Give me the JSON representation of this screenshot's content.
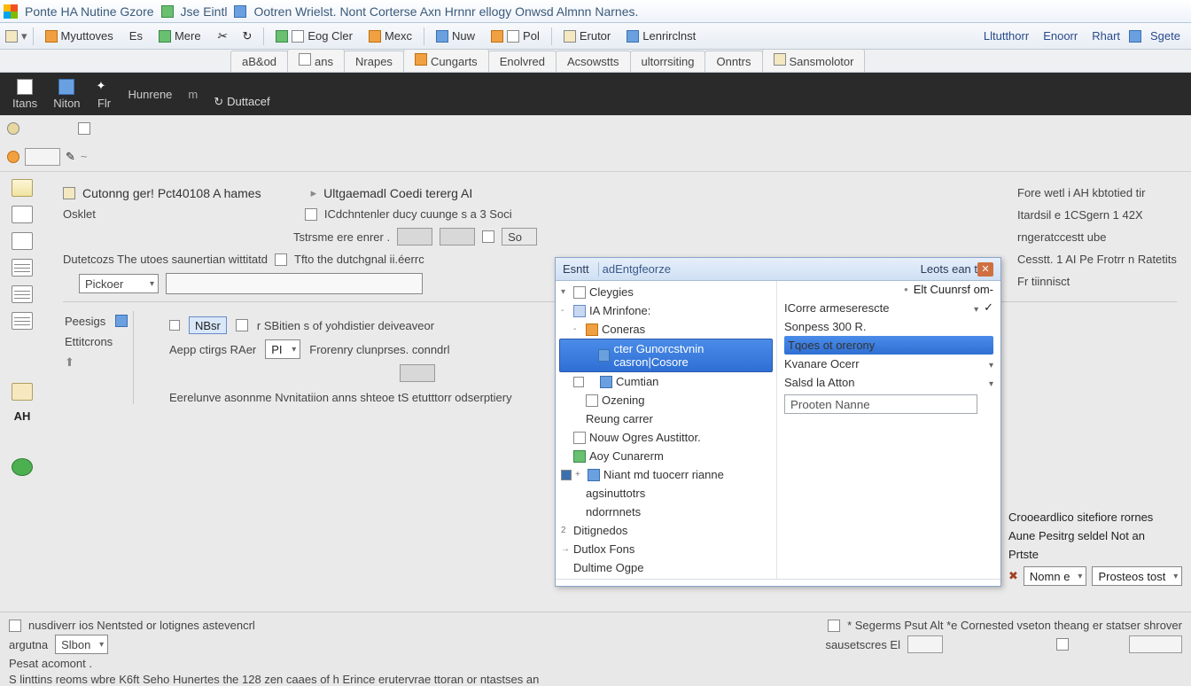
{
  "titlebar": {
    "segments": [
      "Ponte HA Nutine Gzore",
      "Jse Eintl",
      "Ootren Wrielst. Nont Corterse Axn Hrnnr ellogy   Onwsd Almnn Narnes."
    ]
  },
  "ribbon": {
    "items": [
      {
        "label": "Myuttoves"
      },
      {
        "label": "Es"
      },
      {
        "label": "Mere"
      },
      {
        "label": ""
      },
      {
        "label": ""
      },
      {
        "label": "Eog Cler"
      },
      {
        "label": "Mexc"
      },
      {
        "label": "Nuw"
      },
      {
        "label": "Pol"
      },
      {
        "label": "Erutor"
      },
      {
        "label": "Lenrirclnst"
      }
    ],
    "links": [
      "Lltutthorr",
      "Enoorr",
      "Rhart",
      "Sgete"
    ]
  },
  "tabs": [
    {
      "label": "aB&od"
    },
    {
      "label": "ans"
    },
    {
      "label": "Nrapes"
    },
    {
      "label": "Cungarts"
    },
    {
      "label": "Enolvred"
    },
    {
      "label": "Acsowstts"
    },
    {
      "label": "ultorrsiting"
    },
    {
      "label": "Onntrs"
    },
    {
      "label": "Sansmolotor"
    }
  ],
  "darkbar": {
    "items": [
      "Itans",
      "Niton",
      "Flr",
      "Hunrene"
    ],
    "link": "Duttacef"
  },
  "toolbar3": {
    "al_lbl": "AH",
    "combo": "Pickoer"
  },
  "main": {
    "heading": "Cutonng ger!   Pct40108 A hames",
    "heading_right": "Ultgaemadl   Coedi tererg AI",
    "osklet": "Osklet",
    "cdch": "ICdchntenler ducy cuunge s a 3 Soci",
    "streams": "Tstrsme ere enrer .",
    "so_btn": "So",
    "detect": "Dutetcozs The utoes saunertian wittitatd",
    "detect2": "Tfto the dutchgnal ii.éerrc",
    "list": [
      "Peesigs",
      "Ettitcrons"
    ],
    "form_line1_lbl": "NBsr",
    "form_line1_txt": "r SBitien s of yohdistier deiveaveor",
    "form_line2_lbl": "Aepp ctirgs RAer",
    "form_line2_combo": "PI",
    "form_line2_txt": "Frorenry clunprses. conndrl",
    "longtext": "Eerelunve asonnme Nvnitatiion anns shteoe tS etutttorr odserptiery"
  },
  "rightclip": {
    "lines": [
      "Fore wetl i AH kbtotied tir",
      "Itardsil e 1CSgern 1 42X",
      "rngeratccestt ube",
      "Cesstt. 1 AI Pe Frotrr n Ratetits",
      "Fr tiinnisct"
    ]
  },
  "behind": {
    "lines": [
      {
        "txt": "Crooeardlico sitefiore rornes"
      },
      {
        "txt": "Aune Pesitrg seldel Not   an"
      },
      {
        "txt": "Prtste"
      },
      {
        "lbl": "Nomn e",
        "combo": "Prosteos tost"
      }
    ]
  },
  "bottom": {
    "r1_left": "nusdiverr  ios Nentsted or lotignes astevencrl",
    "r1_right": "* Segerms   Psut Alt *e Cornested vseton theang er statser   shrover",
    "r2_left_lbl": "argutna",
    "r2_left_btn": "Slbon",
    "r2_right": "sausetscres El",
    "r3": "Pesat acomont .",
    "r4": "S linttins reoms wbre K6ft Seho   Hunertes the 128  zen caaes of h Erince erutervrae ttoran or ntastses an"
  },
  "dd": {
    "title_left": "Esntt",
    "title_field": "adEntgfeorze",
    "title_right": "Leots ean t",
    "cat_header": "Cleygies",
    "pill": "Elt Cuunrsf om-",
    "tree": [
      {
        "lvl": 0,
        "exp": "-",
        "ic": "db",
        "label": "IA Mrinfone:"
      },
      {
        "lvl": 1,
        "exp": "-",
        "ic": "orange",
        "label": "Coneras"
      },
      {
        "lvl": 2,
        "exp": "",
        "ic": "blue",
        "label": "cter   Gunorcstvnin casron|Cosore",
        "sel": true
      },
      {
        "lvl": 1,
        "exp": "",
        "ic": "blue",
        "label": "Cumtian",
        "chk": true
      },
      {
        "lvl": 1,
        "exp": "",
        "ic": "doc",
        "label": "Ozening"
      },
      {
        "lvl": 1,
        "exp": "",
        "ic": "",
        "label": "Reung carrer"
      },
      {
        "lvl": 0,
        "exp": "",
        "ic": "doc",
        "label": "Nouw Ogres Austittor."
      },
      {
        "lvl": 0,
        "exp": "",
        "ic": "green",
        "label": "Aoy Cunarerm"
      },
      {
        "lvl": 0,
        "exp": "+",
        "ic": "blue",
        "label": "Niant md tuocerr rianne",
        "chk2": true
      },
      {
        "lvl": 1,
        "exp": "",
        "ic": "",
        "label": "agsinuttotrs"
      },
      {
        "lvl": 1,
        "exp": "",
        "ic": "",
        "label": "ndorrnnets"
      },
      {
        "lvl": 0,
        "exp": "2",
        "ic": "",
        "label": "Ditignedos"
      },
      {
        "lvl": 0,
        "exp": "→",
        "ic": "",
        "label": "Dutlox Fons"
      },
      {
        "lvl": 0,
        "exp": "",
        "ic": "",
        "label": "Dultime Ogpe"
      }
    ],
    "props": [
      {
        "label": "ICorre armeserescte",
        "drop": true,
        "chk": true
      },
      {
        "label": "Sonpess 300 R."
      },
      {
        "label": "Tqoes ot orerony",
        "sel": true
      },
      {
        "label": "Kvanare Ocerr",
        "drop": true
      },
      {
        "label": "Salsd la Atton",
        "drop": true
      }
    ],
    "input_value": "Prooten Nanne"
  }
}
